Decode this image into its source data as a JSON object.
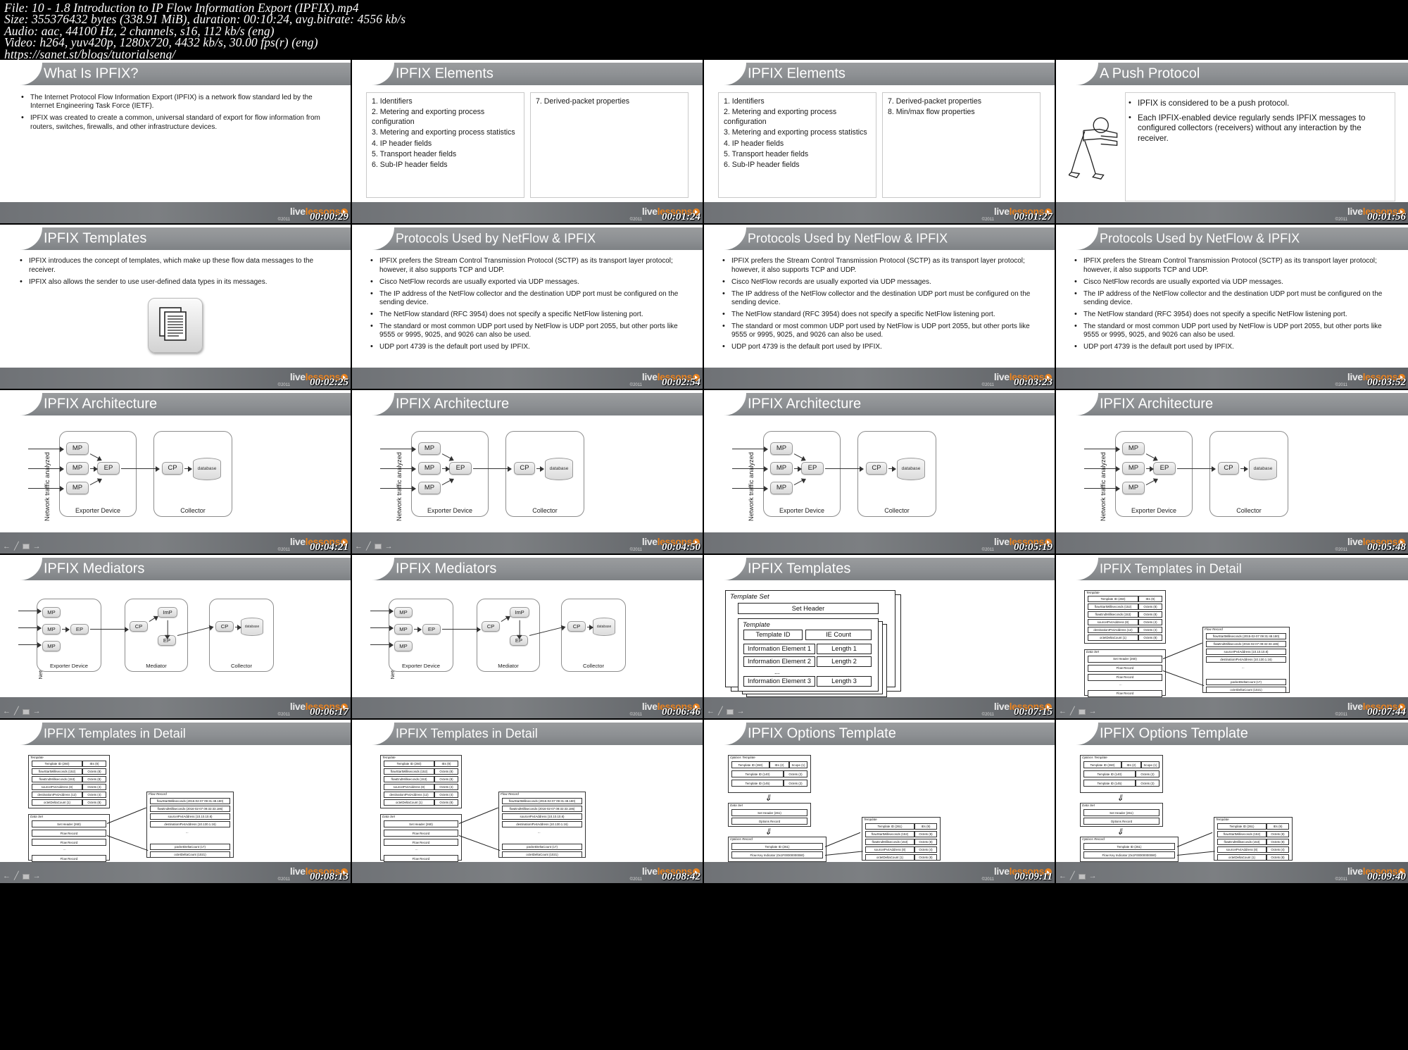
{
  "header": {
    "file_line": "File: 10 - 1.8 Introduction to IP Flow Information Export (IPFIX).mp4",
    "size_line": "Size: 355376432 bytes (338.91 MiB), duration: 00:10:24, avg.bitrate: 4556 kb/s",
    "audio_line": "Audio: aac, 44100 Hz, 2 channels, s16, 112 kb/s (eng)",
    "video_line": "Video: h264, yuv420p, 1280x720, 4432 kb/s, 30.00 fps(r) (eng)",
    "url_line": "https://sanet.st/blogs/tutorialseng/"
  },
  "watermark": {
    "brand_part1": "live",
    "brand_part2": "lessons",
    "copyright": "©2011"
  },
  "slides": [
    {
      "index": 1,
      "timecode": "00:00:29",
      "title": "What Is IPFIX?",
      "layout": "bullets",
      "bullets": [
        "The Internet Protocol Flow Information Export (IPFIX) is a network flow standard led by the Internet Engineering Task Force (IETF).",
        "IPFIX was created to create a common, universal standard of export for flow information from routers, switches, firewalls, and other infrastructure devices."
      ]
    },
    {
      "index": 2,
      "timecode": "00:01:24",
      "title": "IPFIX Elements",
      "layout": "elements",
      "left_items": [
        "1. Identifiers",
        "2. Metering and exporting process configuration",
        "3. Metering and exporting process statistics",
        "4. IP header fields",
        "5. Transport header fields",
        "6. Sub-IP header fields"
      ],
      "right_items": [
        "7. Derived-packet properties"
      ]
    },
    {
      "index": 3,
      "timecode": "00:01:27",
      "title": "IPFIX Elements",
      "layout": "elements",
      "left_items": [
        "1. Identifiers",
        "2. Metering and exporting process configuration",
        "3. Metering and exporting process statistics",
        "4. IP header fields",
        "5. Transport header fields",
        "6. Sub-IP header fields"
      ],
      "right_items": [
        "7. Derived-packet properties",
        "8. Min/max flow properties"
      ]
    },
    {
      "index": 4,
      "timecode": "00:01:56",
      "title": "A Push Protocol",
      "layout": "push",
      "bullets": [
        "IPFIX is considered to be a push protocol.",
        "Each IPFIX-enabled device regularly sends IPFIX messages to configured collectors (receivers) without any interaction by the receiver."
      ]
    },
    {
      "index": 5,
      "timecode": "00:02:25",
      "title": "IPFIX Templates",
      "layout": "templates-intro",
      "bullets": [
        "IPFIX introduces the concept of templates, which make up these flow data messages to the receiver.",
        "IPFIX also allows the sender to use user-defined data types in its messages."
      ]
    },
    {
      "index": 6,
      "timecode": "00:02:54",
      "title": "Protocols Used by NetFlow & IPFIX",
      "layout": "protocols"
    },
    {
      "index": 7,
      "timecode": "00:03:23",
      "title": "Protocols Used by NetFlow & IPFIX",
      "layout": "protocols"
    },
    {
      "index": 8,
      "timecode": "00:03:52",
      "title": "Protocols Used by NetFlow & IPFIX",
      "layout": "protocols"
    },
    {
      "index": 9,
      "timecode": "00:04:21",
      "title": "IPFIX Architecture",
      "layout": "arch"
    },
    {
      "index": 10,
      "timecode": "00:04:50",
      "title": "IPFIX Architecture",
      "layout": "arch"
    },
    {
      "index": 11,
      "timecode": "00:05:19",
      "title": "IPFIX Architecture",
      "layout": "arch"
    },
    {
      "index": 12,
      "timecode": "00:05:48",
      "title": "IPFIX Architecture",
      "layout": "arch"
    },
    {
      "index": 13,
      "timecode": "00:06:17",
      "title": "IPFIX Mediators",
      "layout": "mediators"
    },
    {
      "index": 14,
      "timecode": "00:06:46",
      "title": "IPFIX Mediators",
      "layout": "mediators"
    },
    {
      "index": 15,
      "timecode": "00:07:15",
      "title": "IPFIX Templates",
      "layout": "template-set"
    },
    {
      "index": 16,
      "timecode": "00:07:44",
      "title": "IPFIX Templates in Detail",
      "layout": "detail"
    },
    {
      "index": 17,
      "timecode": "00:08:13",
      "title": "IPFIX Templates in Detail",
      "layout": "detail"
    },
    {
      "index": 18,
      "timecode": "00:08:42",
      "title": "IPFIX Templates in Detail",
      "layout": "detail"
    },
    {
      "index": 19,
      "timecode": "00:09:11",
      "title": "IPFIX Options Template",
      "layout": "options"
    },
    {
      "index": 20,
      "timecode": "00:09:40",
      "title": "IPFIX Options Template",
      "layout": "options"
    }
  ],
  "protocols_bullets": [
    "IPFIX prefers the Stream Control Transmission Protocol (SCTP) as its transport layer protocol; however, it also supports TCP and UDP.",
    "Cisco NetFlow records are usually exported via UDP messages.",
    "The IP address of the NetFlow collector and the destination UDP port must be configured on the sending device.",
    "The NetFlow standard (RFC 3954) does not specify a specific NetFlow listening port.",
    "The standard or most common UDP port used by NetFlow is UDP port 2055, but other ports like 9555 or 9995, 9025, and 9026 can also be used.",
    "UDP port 4739 is the default port used by IPFIX."
  ],
  "arch_diagram": {
    "axis_label": "Network traffic analyzed",
    "exporter_label": "Exporter Device",
    "collector_label": "Collector",
    "mp_label": "MP",
    "ep_label": "EP",
    "cp_label": "CP",
    "db_label": "database"
  },
  "mediator_diagram": {
    "axis_label": "Network traffic analyzed",
    "exporter_label": "Exporter Device",
    "mediator_label": "Mediator",
    "collector_label": "Collector",
    "mp_label": "MP",
    "ep_label": "EP",
    "cp_label": "CP",
    "imp_label": "ImP",
    "db_label": "database"
  },
  "template_set": {
    "set_label": "Template Set",
    "set_header": "Set Header",
    "template_label": "Template",
    "template_id": "Template ID",
    "ie_count": "IE Count",
    "rows": [
      {
        "ie": "Information Element 1",
        "len": "Length 1"
      },
      {
        "ie": "Information Element 2",
        "len": "Length 2"
      },
      {
        "ie": "Information Element 3",
        "len": "Length 3"
      }
    ],
    "ellipsis": "..."
  },
  "detail_diagram": {
    "template_label": "Template",
    "data_set_label": "Data Set",
    "flow_record_label": "Flow Record",
    "set_header_label": "Set Header (260)",
    "ellipsis": "...",
    "template_rows": [
      {
        "left": "Template ID (260)",
        "right": "IEs (9)"
      },
      {
        "left": "flowStartMilliseconds (152)",
        "right": "Octets (8)"
      },
      {
        "left": "flowEndMilliseconds (153)",
        "right": "Octets (8)"
      },
      {
        "left": "sourceIPv4Address (8)",
        "right": "Octets (4)"
      },
      {
        "left": "destinationIPv4Address (12)",
        "right": "Octets (4)"
      },
      {
        "left": "octetDeltaCount (1)",
        "right": "Octets (8)"
      }
    ],
    "flow_rows": [
      "flowStartMilliseconds (2015-02-07 09:31:48.180)",
      "flowEndMilliseconds (2016-02-07 09:32:33.186)",
      "sourceIPv4Address (10.10.10.8)",
      "destinationIPv4Address (10.130.1.16)",
      "packetDeltaCount (17)",
      "octetDeltaCount (1021)"
    ]
  },
  "options_diagram": {
    "options_template_label": "Options Template",
    "data_set_label": "Data Set",
    "set_header_label": "Set Header (261)",
    "options_record_label": "Options Record",
    "template_label": "Template",
    "rows": [
      {
        "a": "Template ID (260)",
        "b": "IEs (2)",
        "c": "Scope (1)"
      },
      {
        "a": "Template ID (140)",
        "b": "Octets (2)"
      },
      {
        "a": "Template ID (145)",
        "b": "Octets (2)"
      }
    ],
    "record_id": "Template ID (261)",
    "flow_key": "Flow Key Indicator (0x1F00000000080)",
    "right_rows": [
      {
        "left": "Template ID (261)",
        "right": "IEs (9)"
      },
      {
        "left": "flowStartMilliseconds (152)",
        "right": "Octets (8)"
      },
      {
        "left": "flowEndMilliseconds (153)",
        "right": "Octets (8)"
      },
      {
        "left": "sourceIPv4Address (8)",
        "right": "Octets (4)"
      },
      {
        "left": "octetDeltaCount (1)",
        "right": "Octets (8)"
      }
    ]
  },
  "player_chrome": {
    "prev_icon": "arrow-left",
    "pencil_icon": "pencil",
    "screen_icon": "screen",
    "next_icon": "arrow-right"
  }
}
